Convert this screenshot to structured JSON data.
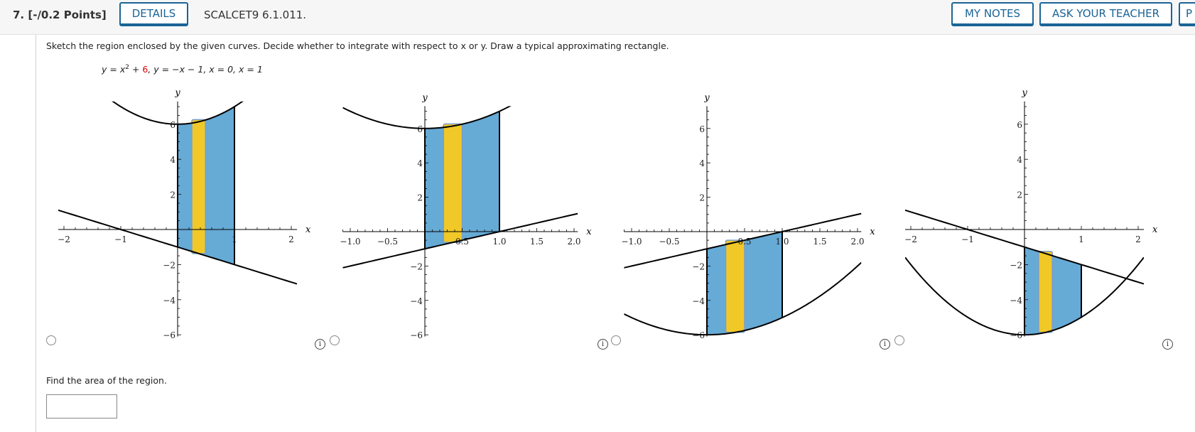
{
  "header": {
    "question_number": "7. [-/0.2 Points]",
    "details_label": "DETAILS",
    "problem_code": "SCALCET9 6.1.011.",
    "my_notes_label": "MY NOTES",
    "ask_teacher_label": "ASK YOUR TEACHER",
    "third_button_label": "P"
  },
  "question": {
    "prompt": "Sketch the region enclosed by the given curves. Decide whether to integrate with respect to x or y. Draw a typical approximating rectangle.",
    "equation": {
      "y1_lhs": "y = x",
      "y1_exp": "2",
      "y1_plus": " + ",
      "y1_const": "6",
      "rest": ",   y = −x − 1,   x = 0,   x = 1"
    },
    "find_area": "Find the area of the region.",
    "answer_value": ""
  },
  "colors": {
    "region_fill": "#66aad6",
    "rectangle_fill": "#f0c828",
    "rectangle_stroke": "#7a9ccc",
    "curve": "#000000"
  },
  "options_icons": {
    "radio": "radio-button",
    "info": "info-icon",
    "info_glyph": "i"
  },
  "chart_data": [
    {
      "type": "area",
      "xlabel": "x",
      "ylabel": "y",
      "xlim": [
        -2.1,
        2.1
      ],
      "ylim": [
        -6.1,
        7.3
      ],
      "xticks": [
        -2,
        -1,
        1,
        2
      ],
      "xtick_labels": [
        "−2",
        "−1",
        "1",
        "2"
      ],
      "x_minor": 0.2,
      "yticks": [
        -6,
        -4,
        -2,
        2,
        4,
        6
      ],
      "ytick_labels": [
        "−6",
        "−4",
        "−2",
        "2",
        "4",
        "6"
      ],
      "y_minor": 0.5,
      "upper_curve": [
        1,
        0,
        6
      ],
      "lower_curve": [
        0,
        -1,
        -1
      ],
      "region_x": [
        0,
        1
      ],
      "rectangle_x": [
        0.25,
        0.49
      ]
    },
    {
      "type": "area",
      "xlabel": "x",
      "ylabel": "y",
      "xlim": [
        -1.1,
        2.05
      ],
      "ylim": [
        -6.1,
        7.3
      ],
      "xticks": [
        -1,
        -0.5,
        0.5,
        1,
        1.5,
        2
      ],
      "xtick_labels": [
        "−1.0",
        "−0.5",
        "0.5",
        "1.0",
        "1.5",
        "2.0"
      ],
      "x_minor": 0.1,
      "yticks": [
        -6,
        -4,
        -2,
        2,
        4,
        6
      ],
      "ytick_labels": [
        "−6",
        "−4",
        "−2",
        "2",
        "4",
        "6"
      ],
      "y_minor": 0.5,
      "upper_curve": [
        1,
        0,
        6
      ],
      "lower_curve": [
        0,
        1,
        -1
      ],
      "region_x": [
        0,
        1
      ],
      "rectangle_x": [
        0.25,
        0.5
      ]
    },
    {
      "type": "area",
      "xlabel": "x",
      "ylabel": "y",
      "xlim": [
        -1.1,
        2.05
      ],
      "ylim": [
        -6.1,
        7.3
      ],
      "xticks": [
        -1,
        -0.5,
        0.5,
        1,
        1.5,
        2
      ],
      "xtick_labels": [
        "−1.0",
        "−0.5",
        "0.5",
        "1.0",
        "1.5",
        "2.0"
      ],
      "x_minor": 0.1,
      "yticks": [
        -6,
        -4,
        -2,
        2,
        4,
        6
      ],
      "ytick_labels": [
        "−6",
        "−4",
        "−2",
        "2",
        "4",
        "6"
      ],
      "y_minor": 0.5,
      "upper_curve": [
        0,
        1,
        -1
      ],
      "lower_curve": [
        1,
        0,
        -6
      ],
      "region_x": [
        0,
        1
      ],
      "rectangle_x": [
        0.25,
        0.5
      ]
    },
    {
      "type": "area",
      "xlabel": "x",
      "ylabel": "y",
      "xlim": [
        -2.1,
        2.1
      ],
      "ylim": [
        -6.1,
        7.3
      ],
      "xticks": [
        -2,
        -1,
        1,
        2
      ],
      "xtick_labels": [
        "−2",
        "−1",
        "1",
        "2"
      ],
      "x_minor": 0.2,
      "yticks": [
        -6,
        -4,
        -2,
        2,
        4,
        6
      ],
      "ytick_labels": [
        "−6",
        "−4",
        "−2",
        "2",
        "4",
        "6"
      ],
      "y_minor": 0.5,
      "upper_curve": [
        0,
        -1,
        -1
      ],
      "lower_curve": [
        1,
        0,
        -6
      ],
      "region_x": [
        0,
        1
      ],
      "rectangle_x": [
        0.25,
        0.49
      ]
    }
  ]
}
